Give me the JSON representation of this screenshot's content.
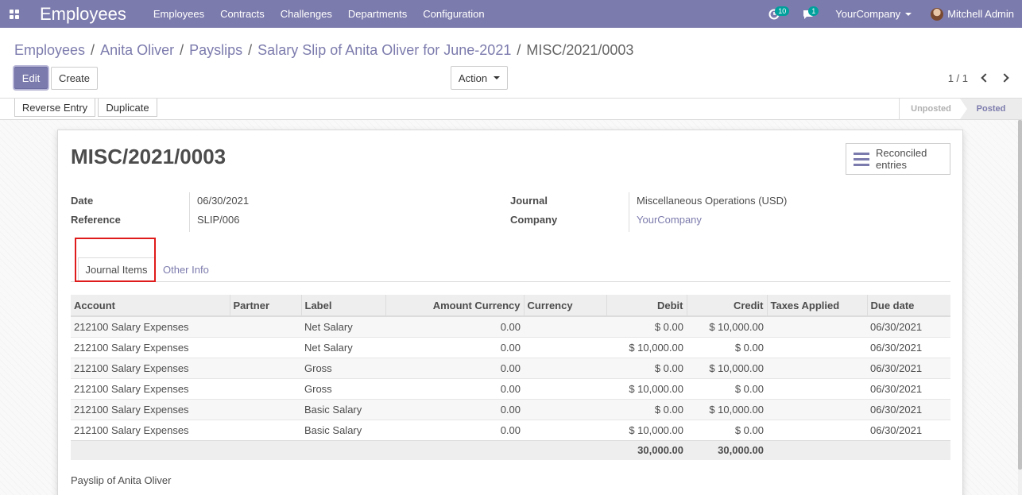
{
  "navbar": {
    "app_title": "Employees",
    "menu": [
      "Employees",
      "Contracts",
      "Challenges",
      "Departments",
      "Configuration"
    ],
    "activities_count": "10",
    "messages_count": "1",
    "company": "YourCompany",
    "user": "Mitchell Admin"
  },
  "breadcrumb": [
    "Employees",
    "Anita Oliver",
    "Payslips",
    "Salary Slip of Anita Oliver for June-2021",
    "MISC/2021/0003"
  ],
  "controls": {
    "edit_label": "Edit",
    "create_label": "Create",
    "action_label": "Action",
    "pager": "1 / 1"
  },
  "statusbar": {
    "reverse_label": "Reverse Entry",
    "duplicate_label": "Duplicate",
    "stages": [
      "Unposted",
      "Posted"
    ],
    "active_stage": "Posted"
  },
  "form": {
    "name": "MISC/2021/0003",
    "smart_button": "Reconciled entries",
    "date_label": "Date",
    "date": "06/30/2021",
    "reference_label": "Reference",
    "reference": "SLIP/006",
    "journal_label": "Journal",
    "journal": "Miscellaneous Operations (USD)",
    "company_label": "Company",
    "company": "YourCompany",
    "tabs": [
      "Journal Items",
      "Other Info"
    ],
    "narration": "Payslip of Anita Oliver"
  },
  "journal_items": {
    "columns": [
      "Account",
      "Partner",
      "Label",
      "Amount Currency",
      "Currency",
      "Debit",
      "Credit",
      "Taxes Applied",
      "Due date"
    ],
    "rows": [
      [
        "212100 Salary Expenses",
        "",
        "Net Salary",
        "0.00",
        "",
        "$ 0.00",
        "$ 10,000.00",
        "",
        "06/30/2021"
      ],
      [
        "212100 Salary Expenses",
        "",
        "Net Salary",
        "0.00",
        "",
        "$ 10,000.00",
        "$ 0.00",
        "",
        "06/30/2021"
      ],
      [
        "212100 Salary Expenses",
        "",
        "Gross",
        "0.00",
        "",
        "$ 0.00",
        "$ 10,000.00",
        "",
        "06/30/2021"
      ],
      [
        "212100 Salary Expenses",
        "",
        "Gross",
        "0.00",
        "",
        "$ 10,000.00",
        "$ 0.00",
        "",
        "06/30/2021"
      ],
      [
        "212100 Salary Expenses",
        "",
        "Basic Salary",
        "0.00",
        "",
        "$ 0.00",
        "$ 10,000.00",
        "",
        "06/30/2021"
      ],
      [
        "212100 Salary Expenses",
        "",
        "Basic Salary",
        "0.00",
        "",
        "$ 10,000.00",
        "$ 0.00",
        "",
        "06/30/2021"
      ]
    ],
    "total_debit": "30,000.00",
    "total_credit": "30,000.00"
  },
  "colors": {
    "brand": "#7c7bad",
    "highlight": "#e01b1b"
  }
}
